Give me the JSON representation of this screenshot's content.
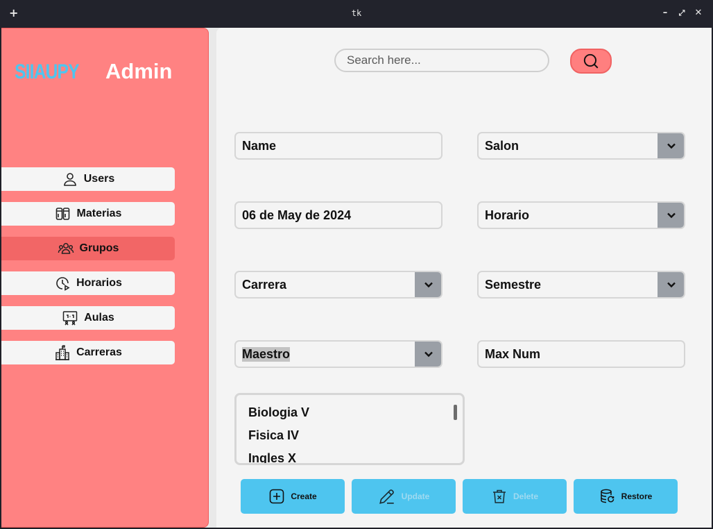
{
  "window": {
    "title": "tk",
    "new_glyph": "+",
    "minimize_glyph": "–",
    "maximize_glyph": "⤢",
    "close_glyph": "✕"
  },
  "sidebar": {
    "logo": "SIIAUPY",
    "role": "Admin",
    "items": [
      {
        "label": "Users",
        "icon": "user-icon",
        "active": false
      },
      {
        "label": "Materias",
        "icon": "books-icon",
        "active": false
      },
      {
        "label": "Grupos",
        "icon": "group-icon",
        "active": true
      },
      {
        "label": "Horarios",
        "icon": "clock-play-icon",
        "active": false
      },
      {
        "label": "Aulas",
        "icon": "classroom-board-icon",
        "active": false
      },
      {
        "label": "Carreras",
        "icon": "building-icon",
        "active": false
      }
    ]
  },
  "search": {
    "placeholder": "Search here...",
    "value": ""
  },
  "form": {
    "name": "Name",
    "salon": "Salon",
    "date": "06 de May de 2024",
    "horario": "Horario",
    "carrera": "Carrera",
    "semestre": "Semestre",
    "maestro": "Maestro",
    "max_num": "Max Num"
  },
  "materias_list": [
    "Biologia V",
    "Fisica IV",
    "Ingles X"
  ],
  "actions": {
    "create": {
      "label": "Create",
      "enabled": true
    },
    "update": {
      "label": "Update",
      "enabled": false
    },
    "delete": {
      "label": "Delete",
      "enabled": false
    },
    "restore": {
      "label": "Restore",
      "enabled": true
    }
  },
  "colors": {
    "sidebar_bg": "#ff8282",
    "active_nav": "#f26666",
    "accent_blue": "#4ec5ef",
    "combo_arrow": "#9a9fa6"
  }
}
